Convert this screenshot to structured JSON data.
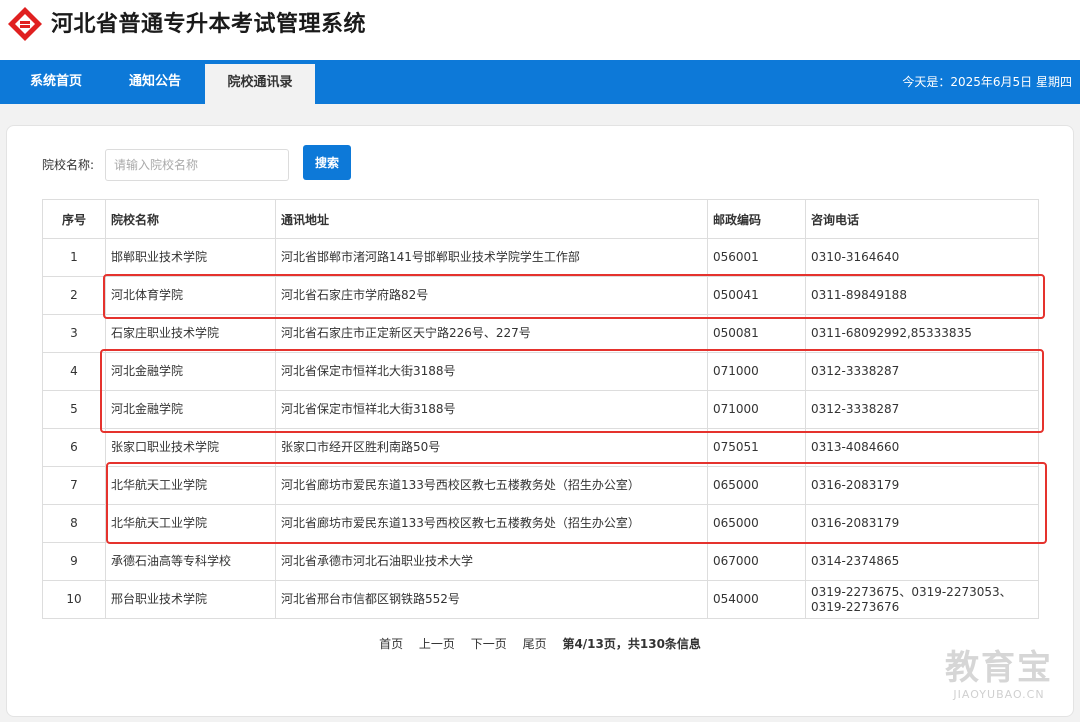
{
  "header": {
    "title": "河北省普通专升本考试管理系统"
  },
  "nav": {
    "items": [
      {
        "label": "系统首页",
        "active": false
      },
      {
        "label": "通知公告",
        "active": false
      },
      {
        "label": "院校通讯录",
        "active": true
      }
    ],
    "today": "今天是：2025年6月5日 星期四"
  },
  "search": {
    "label": "院校名称:",
    "placeholder": "请输入院校名称",
    "value": "",
    "button_label": "搜索"
  },
  "table": {
    "columns": [
      "序号",
      "院校名称",
      "通讯地址",
      "邮政编码",
      "咨询电话"
    ],
    "rows": [
      [
        "1",
        "邯郸职业技术学院",
        "河北省邯郸市渚河路141号邯郸职业技术学院学生工作部",
        "056001",
        "0310-3164640"
      ],
      [
        "2",
        "河北体育学院",
        "河北省石家庄市学府路82号",
        "050041",
        "0311-89849188"
      ],
      [
        "3",
        "石家庄职业技术学院",
        "河北省石家庄市正定新区天宁路226号、227号",
        "050081",
        "0311-68092992,85333835"
      ],
      [
        "4",
        "河北金融学院",
        "河北省保定市恒祥北大街3188号",
        "071000",
        "0312-3338287"
      ],
      [
        "5",
        "河北金融学院",
        "河北省保定市恒祥北大街3188号",
        "071000",
        "0312-3338287"
      ],
      [
        "6",
        "张家口职业技术学院",
        "张家口市经开区胜利南路50号",
        "075051",
        "0313-4084660"
      ],
      [
        "7",
        "北华航天工业学院",
        "河北省廊坊市爱民东道133号西校区教七五楼教务处（招生办公室）",
        "065000",
        "0316-2083179"
      ],
      [
        "8",
        "北华航天工业学院",
        "河北省廊坊市爱民东道133号西校区教七五楼教务处（招生办公室）",
        "065000",
        "0316-2083179"
      ],
      [
        "9",
        "承德石油高等专科学校",
        "河北省承德市河北石油职业技术大学",
        "067000",
        "0314-2374865"
      ],
      [
        "10",
        "邢台职业技术学院",
        "河北省邢台市信都区钢铁路552号",
        "054000",
        "0319-2273675、0319-2273053、0319-2273676"
      ]
    ]
  },
  "pagination": {
    "first": "首页",
    "prev": "上一页",
    "next": "下一页",
    "last": "尾页",
    "info": "第4/13页，共130条信息"
  },
  "watermark": {
    "main": "教育宝",
    "sub": "JIAOYUBAO.CN"
  },
  "colors": {
    "nav_bg": "#0d79d8",
    "highlight": "#e5322d",
    "logo_red": "#e02020"
  }
}
